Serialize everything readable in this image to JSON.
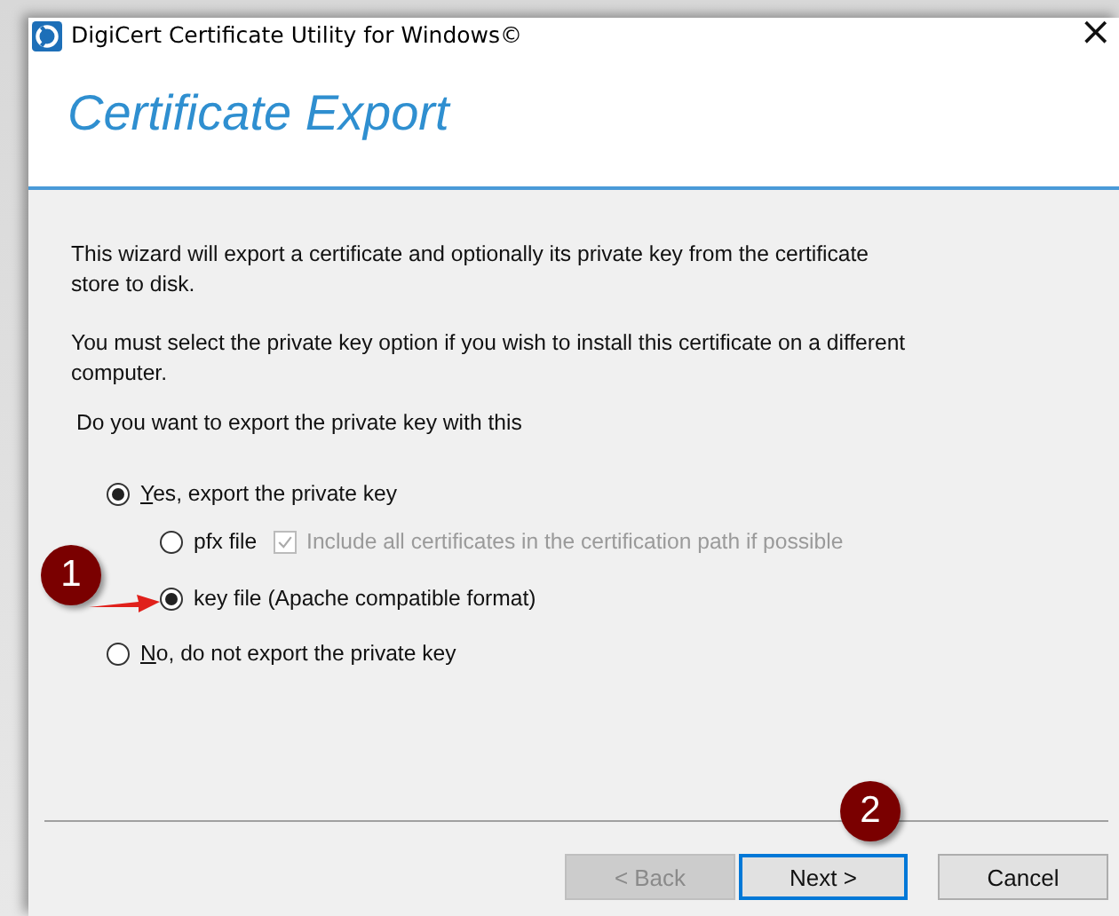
{
  "window": {
    "title": "DigiCert Certificate Utility for Windows©",
    "close": "×"
  },
  "header": {
    "title": "Certificate Export"
  },
  "paragraphs": [
    "This wizard will export a certificate and optionally its private key from the certificate store to disk.",
    "You must select the private key option if you wish to install this certificate on a different computer."
  ],
  "question": "Do you want to export the private key with this",
  "options": [
    {
      "kind": "radio",
      "label": "Yes, export the private key",
      "selected": true,
      "access_key_underlined": true,
      "children": [
        {
          "kind": "radio",
          "label": "pfx file",
          "selected": false,
          "access_key_underlined": false,
          "extra": {
            "kind": "checkbox",
            "label": "Include all certificates in the certification path if possible",
            "checked": true,
            "disabled": true
          }
        },
        {
          "kind": "radio",
          "label": "key file (Apache compatible format)",
          "selected": true,
          "access_key_underlined": false
        }
      ]
    },
    {
      "kind": "radio",
      "label": "No, do not export the private key",
      "selected": false,
      "access_key_underlined": true
    }
  ],
  "buttons": [
    {
      "label": "< Back",
      "disabled": true,
      "default": false
    },
    {
      "label": "Next >",
      "disabled": false,
      "default": true
    },
    {
      "label": "Cancel",
      "disabled": false,
      "default": false
    }
  ],
  "annotations": [
    {
      "kind": "badge",
      "label": "1"
    },
    {
      "kind": "arrow"
    },
    {
      "kind": "badge",
      "label": "2"
    }
  ]
}
